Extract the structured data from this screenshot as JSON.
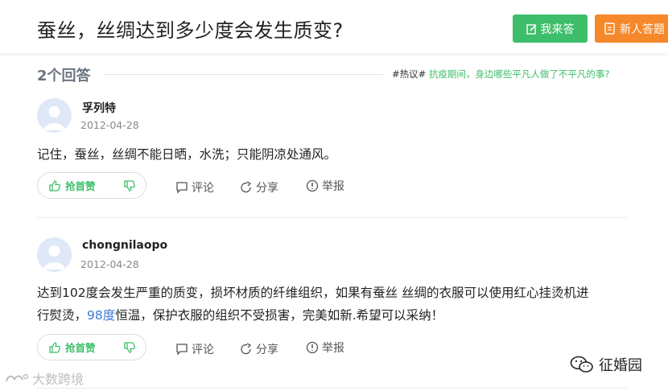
{
  "header": {
    "title": "蚕丝，丝绸达到多少度会发生质变?",
    "answer_button": "我来答",
    "new_button": "新人答题"
  },
  "answers_header": {
    "count_label": "2个回答",
    "hot_prefix": "#热议#",
    "hot_link": "抗疫期间，身边哪些平凡人做了不平凡的事?"
  },
  "answers": [
    {
      "username": "孚列特",
      "date": "2012-04-28",
      "content": "记住，蚕丝，丝绸不能日晒，水洗；只能阴凉处通风。",
      "vote_label": "抢首赞",
      "comment_label": "评论",
      "share_label": "分享",
      "report_label": "举报"
    },
    {
      "username": "chongnilaopo",
      "date": "2012-04-28",
      "content_line1": "达到102度会发生严重的质变，损坏材质的纤维组织，如果有蚕丝 丝绸的衣服可以使用红心挂烫机进",
      "content_line2_pre": "行熨烫，",
      "content_highlight": "98度",
      "content_line2_post": "恒温，保护衣服的组织不受损害，完美如新.希望可以采纳！",
      "vote_label": "抢首赞",
      "comment_label": "评论",
      "share_label": "分享",
      "report_label": "举报"
    }
  ],
  "watermarks": {
    "left": "大数跨境",
    "right": "征婚园"
  },
  "colors": {
    "green": "#3ebe6a",
    "orange": "#f5882a",
    "link_blue": "#3c7ad6"
  }
}
